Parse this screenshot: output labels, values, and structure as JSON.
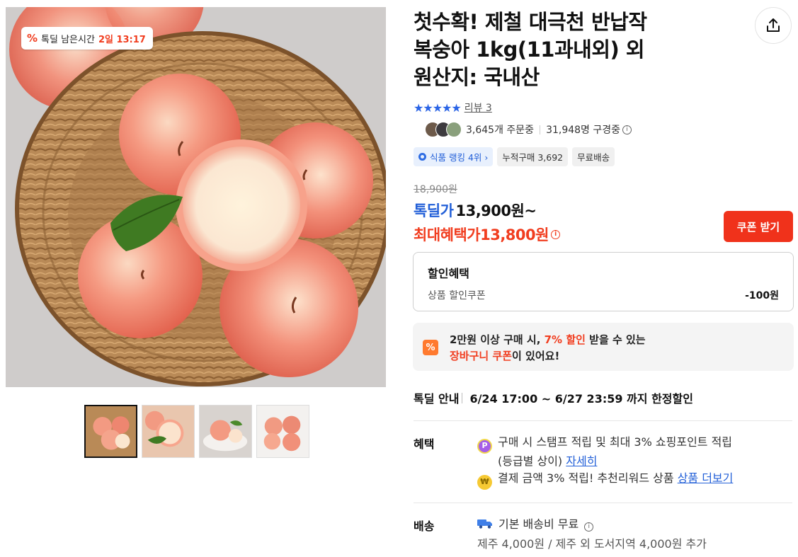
{
  "image": {
    "timer_badge": {
      "icon": "percent-icon",
      "label": "톡딜 남은시간",
      "value": "2일 13:17"
    },
    "thumbnails": [
      "thumbnail-1",
      "thumbnail-2",
      "thumbnail-3",
      "thumbnail-4"
    ]
  },
  "product": {
    "title_lines": [
      "첫수확! 제철 대극천 반납작",
      "복숭아 1kg(11과내외) 외",
      "원산지: 국내산"
    ],
    "stars": "★★★★★",
    "review_label": "리뷰 3",
    "orders": "3,645개 주문중",
    "viewers": "31,948명 구경중"
  },
  "chips": {
    "rank": "식품 랭킹 4위 ›",
    "cumulative": "누적구매 3,692",
    "shipping": "무료배송"
  },
  "price": {
    "original": "18,900원",
    "sale_label": "톡딜가",
    "sale_price": "13,900원~",
    "max_label": "최대혜택가",
    "max_price": "13,800원",
    "coupon_button": "쿠폰 받기"
  },
  "discount": {
    "title": "할인혜택",
    "item_label": "상품 할인쿠폰",
    "item_value": "-100원"
  },
  "cart_coupon": {
    "line1_a": "2만원 이상 구매 시, ",
    "line1_b": "7% 할인",
    "line1_c": " 받을 수 있는",
    "line2_a": "장바구니 쿠폰",
    "line2_b": "이 있어요!"
  },
  "deal": {
    "label": "톡딜 안내",
    "period": "6/24 17:00 ~ 6/27 23:59 까지 한정할인"
  },
  "benefits": {
    "label": "혜택",
    "item1_text": "구매 시 스탬프 적립 및 최대 3% 쇼핑포인트 적립",
    "item1_text2": "(등급별 상이) ",
    "item1_link": "자세히",
    "item2_text": "결제 금액 3% 적립! 추천리워드 상품 ",
    "item2_link": "상품 더보기"
  },
  "shipping": {
    "label": "배송",
    "basic": "기본 배송비 무료",
    "extra": "제주 4,000원 / 제주 외 도서지역 4,000원 추가"
  },
  "colors": {
    "accent_blue": "#2360d8",
    "accent_red": "#f13d1f",
    "coupon_button": "#f0321b"
  }
}
